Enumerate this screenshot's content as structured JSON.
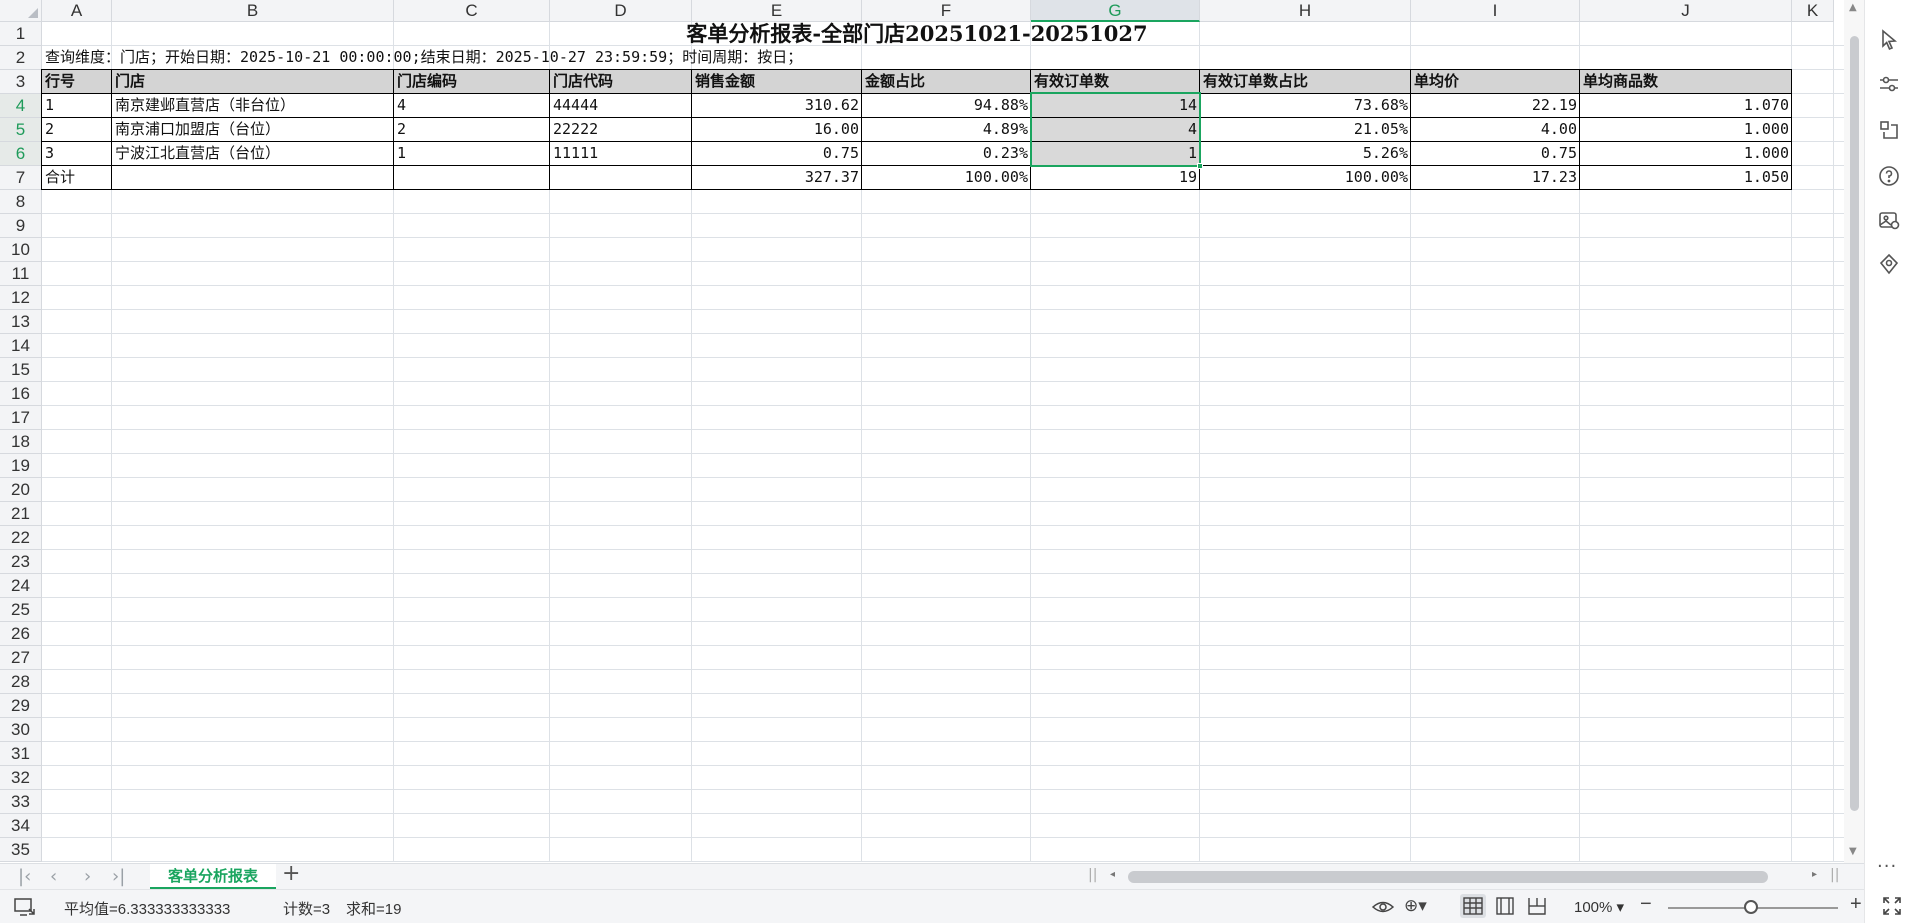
{
  "columns": [
    "A",
    "B",
    "C",
    "D",
    "E",
    "F",
    "G",
    "H",
    "I",
    "J",
    "K"
  ],
  "selected_column": "G",
  "rows": [
    "1",
    "2",
    "3",
    "4",
    "5",
    "6",
    "7",
    "8",
    "9",
    "10",
    "11",
    "12",
    "13",
    "14",
    "15",
    "16",
    "17",
    "18",
    "19",
    "20",
    "21",
    "22",
    "23",
    "24",
    "25",
    "26",
    "27",
    "28",
    "29",
    "30",
    "31",
    "32",
    "33",
    "34",
    "35"
  ],
  "selected_rows": [
    "4",
    "5",
    "6"
  ],
  "report": {
    "title": "客单分析报表-全部门店20251021-20251027",
    "query_info": "查询维度：门店；开始日期：2025-10-21 00:00:00;结束日期：2025-10-27 23:59:59；时间周期：按日；",
    "headers": [
      "行号",
      "门店",
      "门店编码",
      "门店代码",
      "销售金额",
      "金额占比",
      "有效订单数",
      "有效订单数占比",
      "单均价",
      "单均商品数"
    ],
    "data_rows": [
      [
        "1",
        "南京建邺直营店（非台位）",
        "4",
        "44444",
        "310.62",
        "94.88%",
        "14",
        "73.68%",
        "22.19",
        "1.070"
      ],
      [
        "2",
        "南京浦口加盟店（台位）",
        "2",
        "22222",
        "16.00",
        "4.89%",
        "4",
        "21.05%",
        "4.00",
        "1.000"
      ],
      [
        "3",
        "宁波江北直营店（台位）",
        "1",
        "11111",
        "0.75",
        "0.23%",
        "1",
        "5.26%",
        "0.75",
        "1.000"
      ]
    ],
    "total_row": [
      "合计",
      "",
      "",
      "",
      "327.37",
      "100.00%",
      "19",
      "100.00%",
      "17.23",
      "1.050"
    ]
  },
  "sheet_tab": "客单分析报表",
  "status": {
    "average": "平均值=6.333333333333",
    "count": "计数=3",
    "sum": "求和=19",
    "zoom": "100%"
  },
  "icons": {
    "rail": [
      "pointer-icon",
      "sliders-icon",
      "transform-icon",
      "help-icon",
      "image-tool-icon",
      "location-icon",
      "more-icon"
    ],
    "status": [
      "monitor-icon",
      "eye-icon",
      "protect-icon",
      "normal-view-icon",
      "page-layout-icon",
      "page-break-icon",
      "zoom-out-icon",
      "zoom-in-icon",
      "fullscreen-icon"
    ]
  },
  "colors": {
    "accent": "#1aa55f",
    "header_fill": "#d4d4d4",
    "selection_fill": "#d9d9d9"
  }
}
